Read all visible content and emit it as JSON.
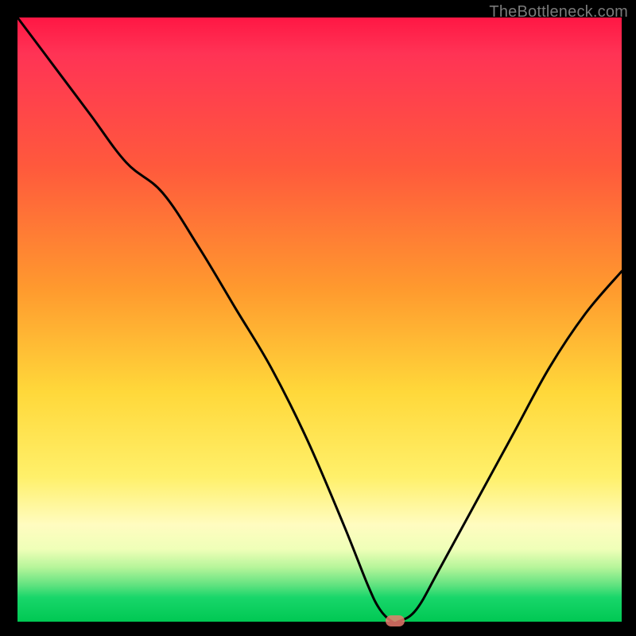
{
  "attribution": "TheBottleneck.com",
  "chart_data": {
    "type": "line",
    "title": "",
    "xlabel": "",
    "ylabel": "",
    "xlim": [
      0,
      100
    ],
    "ylim": [
      0,
      100
    ],
    "series": [
      {
        "name": "bottleneck-curve",
        "x": [
          0,
          6,
          12,
          18,
          24,
          30,
          36,
          42,
          48,
          54,
          58,
          60,
          62,
          63,
          66,
          70,
          76,
          82,
          88,
          94,
          100
        ],
        "y": [
          100,
          92,
          84,
          76,
          71,
          62,
          52,
          42,
          30,
          16,
          6,
          2,
          0,
          0,
          2,
          9,
          20,
          31,
          42,
          51,
          58
        ]
      }
    ],
    "marker": {
      "x": 62.5,
      "y": 0,
      "color": "#ef7b6f"
    },
    "gradient_stops": [
      {
        "pos": 0.0,
        "color": "#ff1744"
      },
      {
        "pos": 0.25,
        "color": "#ff5a3c"
      },
      {
        "pos": 0.45,
        "color": "#ff9a2e"
      },
      {
        "pos": 0.62,
        "color": "#ffd83a"
      },
      {
        "pos": 0.84,
        "color": "#fffcc0"
      },
      {
        "pos": 0.94,
        "color": "#5fe27f"
      },
      {
        "pos": 1.0,
        "color": "#00c853"
      }
    ]
  }
}
